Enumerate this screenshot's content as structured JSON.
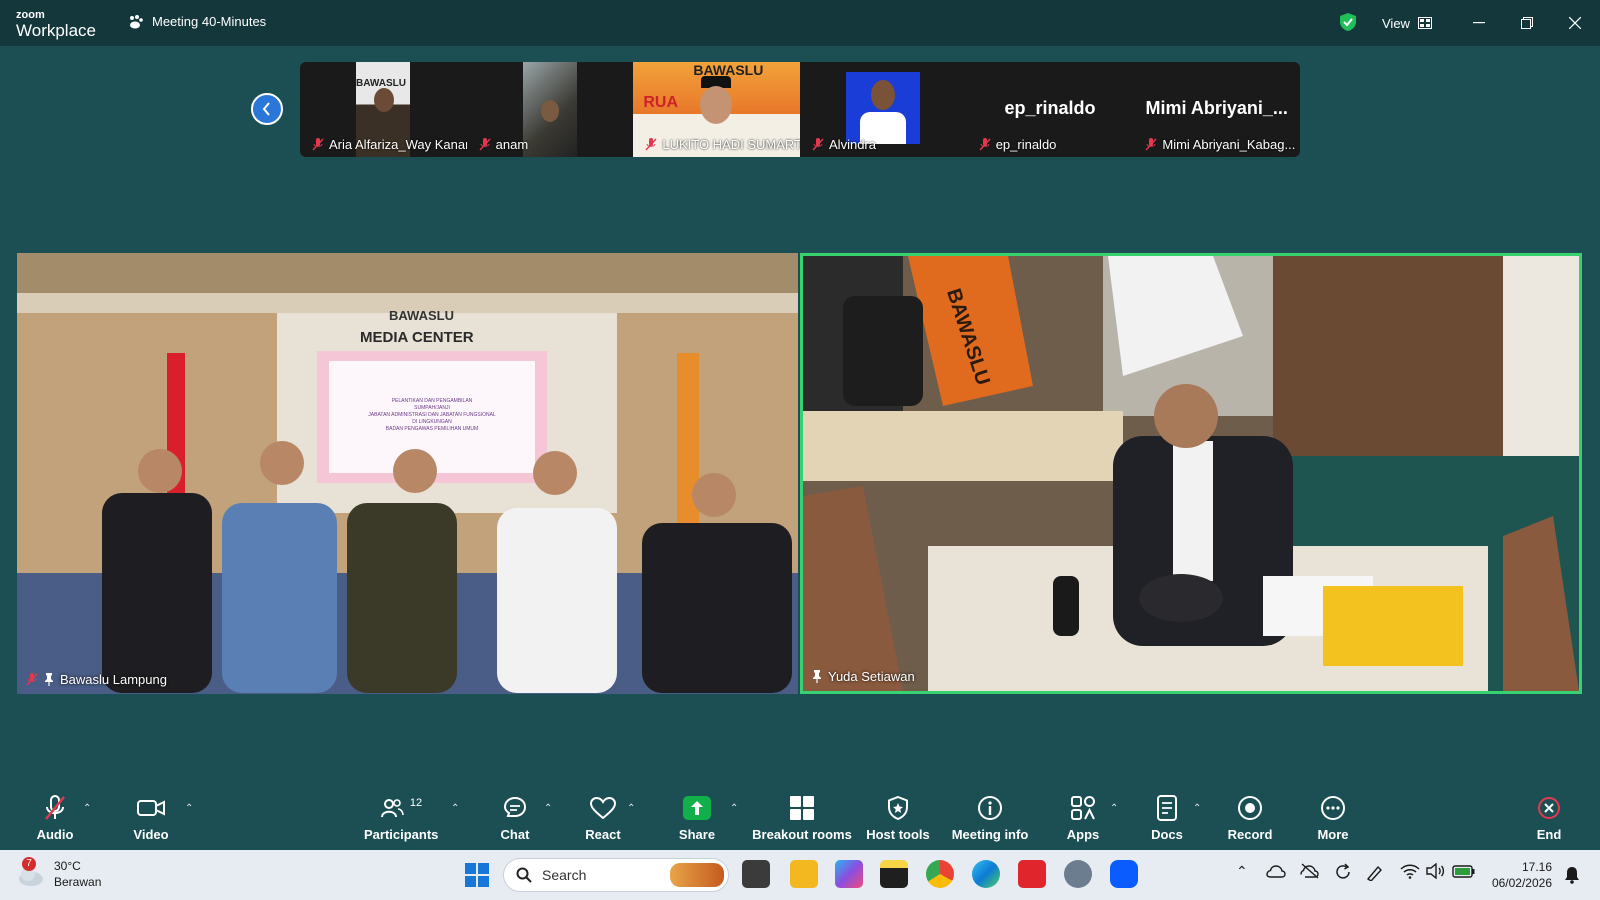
{
  "titlebar": {
    "brand_top": "zoom",
    "brand_bottom": "Workplace",
    "meeting_title": "Meeting 40-Minutes",
    "view_label": "View"
  },
  "filmstrip": {
    "tiles": [
      {
        "name": "Aria Alfariza_Way Kanan",
        "muted": true
      },
      {
        "name": "anam",
        "muted": true
      },
      {
        "name": "LUKITO HADI SUMART...",
        "muted": true
      },
      {
        "name": "Alvindra",
        "muted": true
      },
      {
        "name": "ep_rinaldo",
        "display_name": "ep_rinaldo",
        "muted": true
      },
      {
        "name": "Mimi Abriyani_Kabag...",
        "display_name": "Mimi  Abriyani_...",
        "muted": true
      }
    ]
  },
  "main_videos": {
    "left": {
      "name": "Bawaslu Lampung",
      "muted": true,
      "pinned": true
    },
    "right": {
      "name": "Yuda Setiawan",
      "pinned": true,
      "active_speaker": true
    }
  },
  "video_scene_text": {
    "logo": "BAWASLU",
    "media_center": "MEDIA CENTER",
    "banner_lines": [
      "PELANTIKAN DAN PENGAMBILAN",
      "SUMPAH/JANJI",
      "JABATAN ADMINISTRASI DAN JABATAN FUNGSIONAL",
      "DI LINGKUNGAN",
      "BADAN PENGAWAS PEMILIHAN UMUM"
    ],
    "flag_text": "BAWASLU",
    "thumb_ruang": "RUA"
  },
  "toolbar": {
    "audio": "Audio",
    "video": "Video",
    "participants": "Participants",
    "participant_count": "12",
    "chat": "Chat",
    "react": "React",
    "share": "Share",
    "breakout": "Breakout rooms",
    "host_tools": "Host tools",
    "meeting_info": "Meeting info",
    "apps": "Apps",
    "docs": "Docs",
    "record": "Record",
    "more": "More",
    "end": "End"
  },
  "taskbar": {
    "weather_badge": "7",
    "temperature": "30°C",
    "weather_desc": "Berawan",
    "search_placeholder": "Search",
    "time": "17.16",
    "date": "06/02/2026"
  },
  "colors": {
    "background": "#1b4f53",
    "titlebar": "#14373b",
    "active_speaker_border": "#38d16f",
    "share_green": "#12b04b",
    "end_red": "#e5384f",
    "nav_blue": "#2b77d9",
    "muted_red": "#e5384f"
  },
  "icons": [
    "paw-icon",
    "shield-check-icon",
    "grid-view-icon",
    "minimize-icon",
    "restore-icon",
    "close-icon",
    "chevron-left-icon",
    "mic-muted-icon",
    "pin-icon",
    "video-camera-icon",
    "caret-up-icon",
    "participants-icon",
    "chat-icon",
    "heart-icon",
    "share-arrow-icon",
    "breakout-grid-icon",
    "host-shield-icon",
    "info-icon",
    "apps-icon",
    "docs-icon",
    "record-icon",
    "more-icon",
    "end-x-icon",
    "windows-start-icon",
    "search-icon"
  ]
}
